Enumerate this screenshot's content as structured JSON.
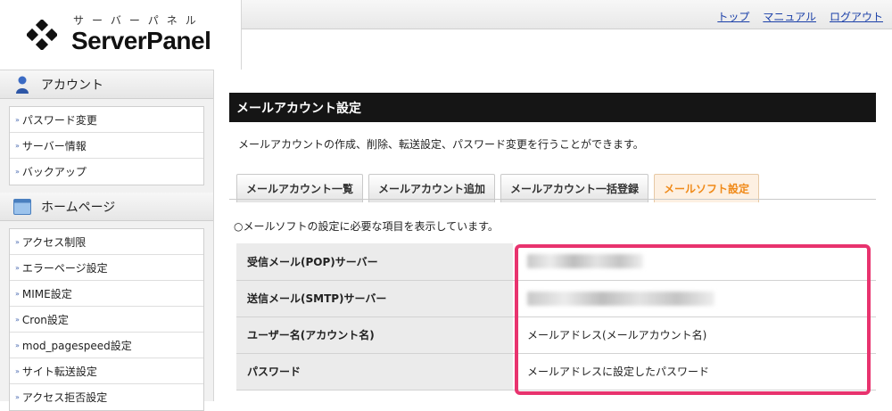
{
  "header": {
    "logo_kana": "サーバーパネル",
    "logo_text": "ServerPanel",
    "links": [
      "トップ",
      "マニュアル",
      "ログアウト"
    ]
  },
  "sidebar": {
    "sections": [
      {
        "title": "アカウント",
        "icon": "user-icon",
        "items": [
          "パスワード変更",
          "サーバー情報",
          "バックアップ"
        ]
      },
      {
        "title": "ホームページ",
        "icon": "window-icon",
        "items": [
          "アクセス制限",
          "エラーページ設定",
          "MIME設定",
          "Cron設定",
          "mod_pagespeed設定",
          "サイト転送設定",
          "アクセス拒否設定"
        ]
      }
    ]
  },
  "main": {
    "title": "メールアカウント設定",
    "description": "メールアカウントの作成、削除、転送設定、パスワード変更を行うことができます。",
    "tabs": [
      {
        "label": "メールアカウント一覧",
        "active": false
      },
      {
        "label": "メールアカウント追加",
        "active": false
      },
      {
        "label": "メールアカウント一括登録",
        "active": false
      },
      {
        "label": "メールソフト設定",
        "active": true
      }
    ],
    "note": "○メールソフトの設定に必要な項目を表示しています。",
    "rows": [
      {
        "label": "受信メール(POP)サーバー",
        "value": ""
      },
      {
        "label": "送信メール(SMTP)サーバー",
        "value": ""
      },
      {
        "label": "ユーザー名(アカウント名)",
        "value": "メールアドレス(メールアカウント名)"
      },
      {
        "label": "パスワード",
        "value": "メールアドレスに設定したパスワード"
      }
    ]
  },
  "colors": {
    "highlight": "#e8336e",
    "active_tab": "#f08a19",
    "link": "#1a3fa8"
  }
}
